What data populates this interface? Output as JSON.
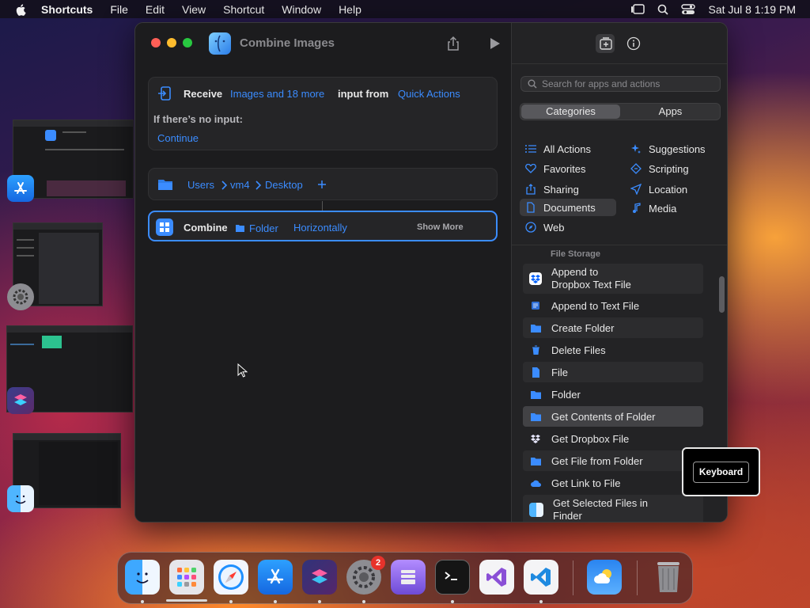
{
  "menubar": {
    "app_name": "Shortcuts",
    "items": [
      "File",
      "Edit",
      "View",
      "Shortcut",
      "Window",
      "Help"
    ],
    "clock": "Sat Jul 8  1:19 PM"
  },
  "window": {
    "title": "Combine Images",
    "receive": {
      "label": "Receive",
      "types": "Images and 18 more",
      "input_from": "input from",
      "source": "Quick Actions",
      "no_input_label": "If there’s no input:",
      "no_input_action": "Continue"
    },
    "path": {
      "segments": [
        "Users",
        "vm4",
        "Desktop"
      ]
    },
    "combine": {
      "label": "Combine",
      "folder": "Folder",
      "mode": "Horizontally",
      "show_more": "Show More"
    }
  },
  "sidebar": {
    "search_placeholder": "Search for apps and actions",
    "segments": [
      "Categories",
      "Apps"
    ],
    "categories_left": [
      {
        "label": "All Actions",
        "icon": "list-icon"
      },
      {
        "label": "Favorites",
        "icon": "heart-icon"
      },
      {
        "label": "Sharing",
        "icon": "share-icon"
      },
      {
        "label": "Documents",
        "icon": "document-icon"
      },
      {
        "label": "Web",
        "icon": "compass-icon"
      }
    ],
    "categories_right": [
      {
        "label": "Suggestions",
        "icon": "sparkle-icon"
      },
      {
        "label": "Scripting",
        "icon": "scripting-icon"
      },
      {
        "label": "Location",
        "icon": "location-icon"
      },
      {
        "label": "Media",
        "icon": "music-icon"
      }
    ],
    "selected_category": "Documents",
    "section_title": "File Storage",
    "actions": [
      {
        "label": "Append to Dropbox Text File",
        "icon": "dropbox-icon"
      },
      {
        "label": "Append to Text File",
        "icon": "text-file-icon"
      },
      {
        "label": "Create Folder",
        "icon": "folder-icon"
      },
      {
        "label": "Delete Files",
        "icon": "trash-icon"
      },
      {
        "label": "File",
        "icon": "file-icon"
      },
      {
        "label": "Folder",
        "icon": "folder-icon"
      },
      {
        "label": "Get Contents of Folder",
        "icon": "folder-icon"
      },
      {
        "label": "Get Dropbox File",
        "icon": "dropbox-icon"
      },
      {
        "label": "Get File from Folder",
        "icon": "folder-icon"
      },
      {
        "label": "Get Link to File",
        "icon": "cloud-icon"
      },
      {
        "label": "Get Selected Files in Finder",
        "icon": "finder-icon"
      }
    ],
    "hovered_action": "Get Contents of Folder"
  },
  "popup": {
    "label": "Keyboard"
  },
  "dock": {
    "apps": [
      "Finder",
      "Launchpad",
      "Safari",
      "App Store",
      "Shortcuts",
      "System Settings",
      "Apple Configurator",
      "Terminal",
      "Visual Studio",
      "Visual Studio Code",
      "Weather",
      "Trash"
    ],
    "settings_badge": "2"
  },
  "colors": {
    "accent": "#3b8cff",
    "window_bg": "#1c1c1e",
    "sidebar_bg": "#232325"
  }
}
